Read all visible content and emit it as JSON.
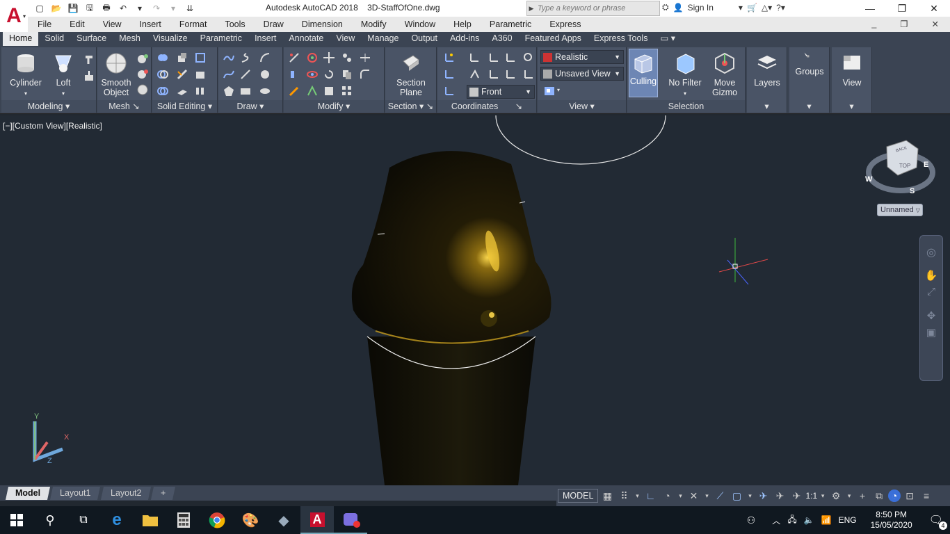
{
  "window": {
    "title": "Autodesk AutoCAD 2018",
    "filename": "3D-StaffOfOne.dwg",
    "search_placeholder": "Type a keyword or phrase",
    "sign_in": "Sign In"
  },
  "menu": [
    "File",
    "Edit",
    "View",
    "Insert",
    "Format",
    "Tools",
    "Draw",
    "Dimension",
    "Modify",
    "Window",
    "Help",
    "Parametric",
    "Express"
  ],
  "ribbon_tabs": [
    "Home",
    "Solid",
    "Surface",
    "Mesh",
    "Visualize",
    "Parametric",
    "Insert",
    "Annotate",
    "View",
    "Manage",
    "Output",
    "Add-ins",
    "A360",
    "Featured Apps",
    "Express Tools"
  ],
  "ribbon": {
    "cylinder": "Cylinder",
    "loft": "Loft",
    "smooth_object": "Smooth\nObject",
    "section_plane": "Section\nPlane",
    "visual_style": "Realistic",
    "named_view": "Unsaved View",
    "ucs_view": "Front",
    "culling": "Culling",
    "no_filter": "No Filter",
    "move_gizmo": "Move\nGizmo",
    "layers": "Layers",
    "groups": "Groups",
    "view": "View",
    "panels": [
      "Modeling",
      "Mesh",
      "Solid Editing",
      "Draw",
      "Modify",
      "Section",
      "Coordinates",
      "View",
      "Selection"
    ]
  },
  "viewport": {
    "label": "[−][Custom View][Realistic]",
    "viewcube": {
      "top": "TOP",
      "back": "BACK",
      "compass_w": "W",
      "compass_e": "E",
      "compass_s": "S"
    },
    "ucs_dropdown": "Unnamed",
    "ucs_axes": {
      "x": "X",
      "y": "Y",
      "z": "Z"
    }
  },
  "layout_tabs": [
    "Model",
    "Layout1",
    "Layout2"
  ],
  "status": {
    "model": "MODEL",
    "scale": "1:1"
  },
  "taskbar": {
    "lang": "ENG",
    "time": "8:50 PM",
    "date": "15/05/2020",
    "notifications": "4"
  },
  "colors": {
    "ribbon_bg": "#3b4453",
    "viewport_bg": "#222a34",
    "accent": "#6d86b4",
    "autocad_red": "#c8102e"
  }
}
